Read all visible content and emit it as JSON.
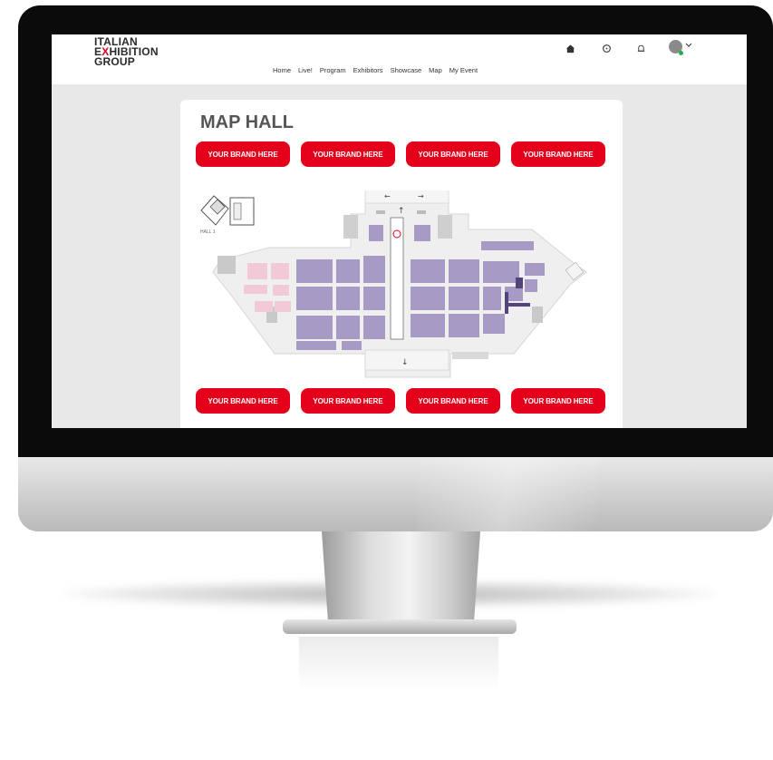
{
  "colors": {
    "accent": "#e4001b",
    "map_booth": "#a79ac5",
    "map_booth_dark": "#53457a",
    "map_floor": "#efefef"
  },
  "logo": {
    "line1": "ITALIAN",
    "line2_prefix": "E",
    "line2_x": "X",
    "line2_rest": "HIBITION",
    "line3": "GROUP"
  },
  "nav": {
    "items": [
      "Home",
      "Live!",
      "Program",
      "Exhibitors",
      "Showcase",
      "Map",
      "My Event"
    ]
  },
  "icons": {
    "home": "home-icon",
    "chat": "chat-icon",
    "bell": "bell-icon",
    "avatar_menu": "chevron-down-icon"
  },
  "page": {
    "title": "MAP HALL",
    "brand_buttons_top": [
      "YOUR BRAND HERE",
      "YOUR BRAND HERE",
      "YOUR BRAND HERE",
      "YOUR BRAND HERE"
    ],
    "brand_buttons_bottom": [
      "YOUR BRAND HERE",
      "YOUR BRAND HERE",
      "YOUR BRAND HERE",
      "YOUR BRAND HERE"
    ],
    "hall_label": "HALL 1"
  }
}
